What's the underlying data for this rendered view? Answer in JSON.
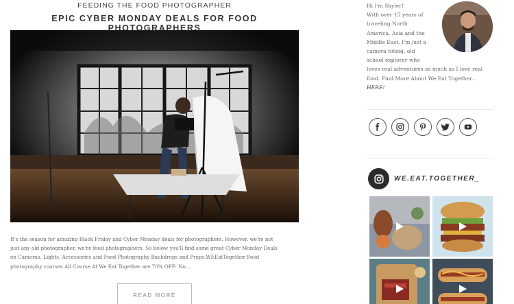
{
  "post": {
    "category": "FEEDING THE FOOD PHOTOGRAPHER",
    "title": "EPIC CYBER MONDAY DEALS FOR FOOD PHOTOGRAPHERS",
    "excerpt_lines": [
      "It's the season for amazing Black Friday and Cyber Monday deals for photographers. However, we're not",
      "just any old photographer, we're food photographers. So below you'll find some great Cyber Monday Deals",
      "on Cameras, Lights, Accessories and Food Photography Backdrops and Props.WEEatTogether Food",
      "photography courses All Course At We Eat Together are 70% OFF: No..."
    ],
    "read_more": "READ MORE"
  },
  "sidebar": {
    "bio_lines": [
      "Hi I'm Skyler!",
      "With over 15 years of",
      "traveling North",
      "America, Asia and the",
      "Middle East, I'm just a",
      "camera toting, old",
      "school explorer who",
      "loves real adventures as much as I love real",
      "food. Find More About We Eat Together..."
    ],
    "bio_link": "HERE!",
    "social": [
      "facebook-icon",
      "instagram-icon",
      "pinterest-icon",
      "twitter-icon",
      "youtube-icon"
    ],
    "instagram_handle": "WE.EAT.TOGETHER_"
  },
  "colors": {
    "text": "#666666",
    "heading": "#333333",
    "divider": "#e8e8e8",
    "badge": "#2b2b2b"
  }
}
